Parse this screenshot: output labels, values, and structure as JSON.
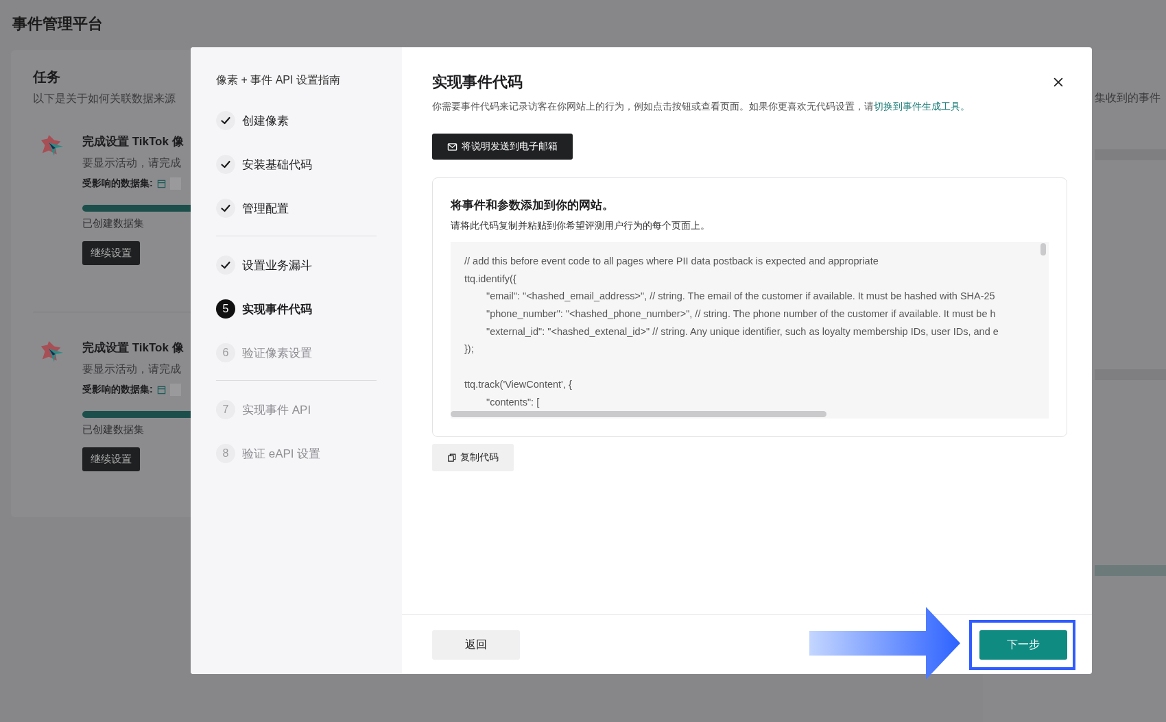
{
  "app_title": "事件管理平台",
  "tasks": {
    "title": "任务",
    "subtitle": "以下是关于如何关联数据来源",
    "items": [
      {
        "title": "完成设置 TikTok 像",
        "desc": "要显示活动，请完成",
        "dataset_label": "受影响的数据集:",
        "level": 1,
        "progress_label": "已创建数据集",
        "button": "继续设置"
      },
      {
        "title": "完成设置 TikTok 像",
        "desc": "要显示活动，请完成",
        "dataset_label": "受影响的数据集:",
        "level": 1,
        "progress_label": "已创建数据集",
        "button": "继续设置"
      }
    ]
  },
  "right_panel": {
    "text": "集收到的事件"
  },
  "modal": {
    "guide": {
      "title": "像素 + 事件 API 设置指南",
      "groups": [
        {
          "steps": [
            {
              "label": "创建像素",
              "kind": "done"
            },
            {
              "label": "安装基础代码",
              "kind": "done"
            },
            {
              "label": "管理配置",
              "kind": "done"
            }
          ]
        },
        {
          "steps": [
            {
              "label": "设置业务漏斗",
              "kind": "done"
            },
            {
              "number": "5",
              "label": "实现事件代码",
              "kind": "current"
            },
            {
              "number": "6",
              "label": "验证像素设置",
              "kind": "todo"
            }
          ]
        },
        {
          "steps": [
            {
              "number": "7",
              "label": "实现事件 API",
              "kind": "todo"
            },
            {
              "number": "8",
              "label": "验证 eAPI 设置",
              "kind": "todo"
            }
          ]
        }
      ]
    },
    "title": "实现事件代码",
    "description": "你需要事件代码来记录访客在你网站上的行为，例如点击按钮或查看页面。如果你更喜欢无代码设置，请",
    "description_link": "切换到事件生成工具。",
    "email_button": "将说明发送到电子邮箱",
    "code_card": {
      "heading": "将事件和参数添加到你的网站。",
      "subheading": "请将此代码复制并粘贴到你希望评测用户行为的每个页面上。",
      "blocks": [
        {
          "lines": [
            {
              "text": "// add this before event code to all pages where PII data postback is expected and appropriate",
              "indent": false
            },
            {
              "text": "ttq.identify({",
              "indent": false
            },
            {
              "text": "\"email\": \"<hashed_email_address>\", // string. The email of the customer if available. It must be hashed with SHA-25",
              "indent": true
            },
            {
              "text": "\"phone_number\": \"<hashed_phone_number>\", // string. The phone number of the customer if available. It must be h",
              "indent": true
            },
            {
              "text": "\"external_id\": \"<hashed_extenal_id>\" // string. Any unique identifier, such as loyalty membership IDs, user IDs, and e",
              "indent": true
            },
            {
              "text": "});",
              "indent": false
            }
          ]
        },
        {
          "lines": [
            {
              "text": "ttq.track('ViewContent', {",
              "indent": false
            },
            {
              "text": "\"contents\": [",
              "indent": true
            }
          ]
        }
      ]
    },
    "copy_button": "复制代码",
    "back_button": "返回",
    "next_button": "下一步"
  }
}
